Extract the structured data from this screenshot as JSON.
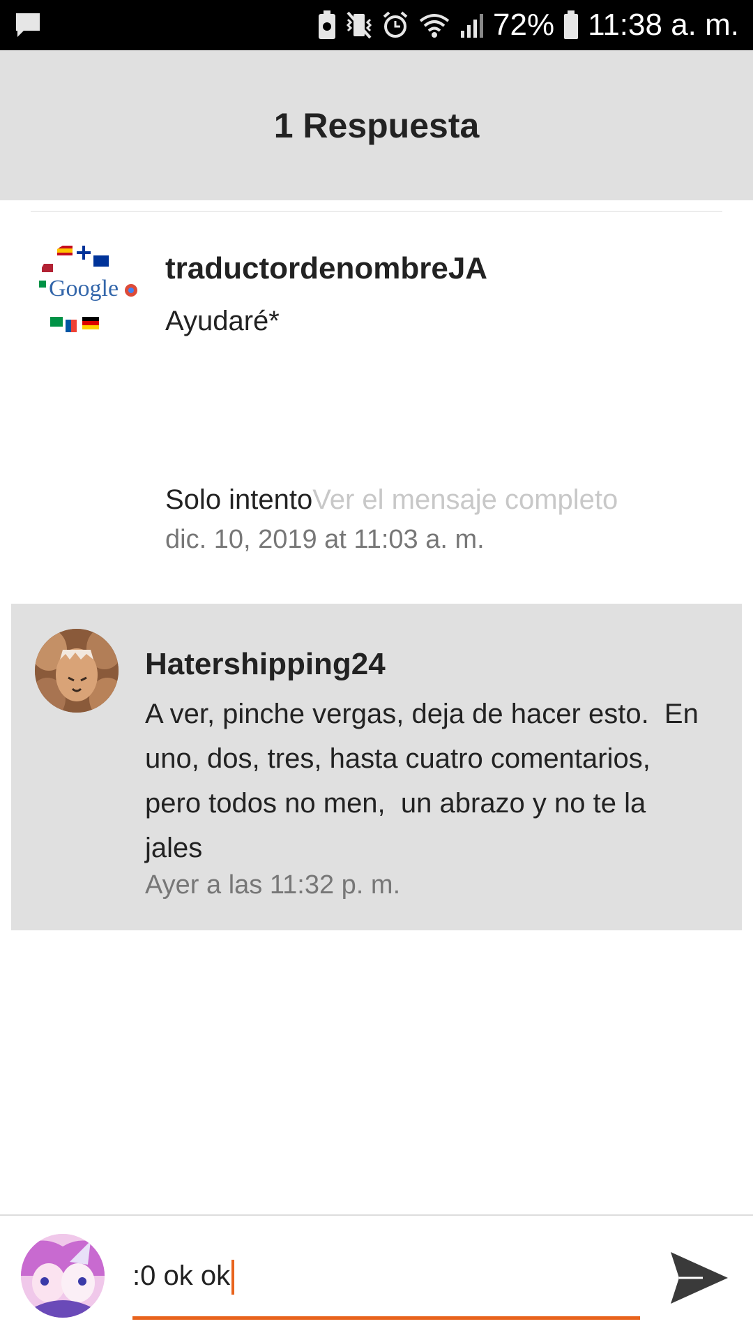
{
  "status_bar": {
    "battery_percent": "72%",
    "time": "11:38 a. m.",
    "icons": [
      "message-icon",
      "battery-saver-icon",
      "vibrate-icon",
      "alarm-icon",
      "wifi-icon",
      "signal-icon",
      "battery-icon"
    ]
  },
  "header": {
    "title": "1 Respuesta"
  },
  "original_comment": {
    "username": "traductordenombreJA",
    "text_line1": "Ayudaré*",
    "text_line2": "Solo intento",
    "see_full": "Ver el mensaje completo",
    "timestamp": "dic. 10, 2019 at 11:03 a. m.",
    "avatar_label": "Google"
  },
  "reply": {
    "username": "Hatershipping24",
    "text_lines": [
      "A ver, pinche vergas, deja de hacer esto.  En",
      "uno, dos, tres, hasta cuatro comentarios,",
      "pero todos no men,  un abrazo y no te la",
      "jales"
    ],
    "timestamp": "Ayer a las 11:32 p. m."
  },
  "composer": {
    "value": ":0 ok ok",
    "send_label": "Enviar"
  },
  "colors": {
    "accent": "#e8631c",
    "header_bg": "#e0e0e0",
    "reply_bg": "#e0e0e0"
  }
}
